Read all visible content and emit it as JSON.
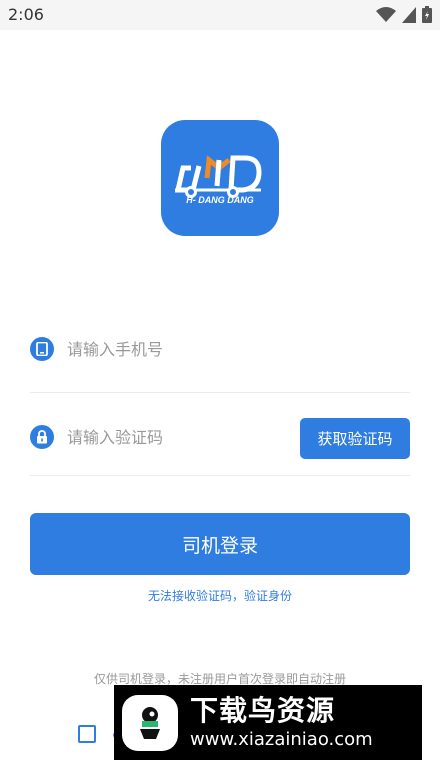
{
  "status_bar": {
    "time": "2:06"
  },
  "logo": {
    "text": "H- DANG DANG"
  },
  "phone_field": {
    "placeholder": "请输入手机号"
  },
  "code_field": {
    "placeholder": "请输入验证码",
    "button_label": "获取验证码"
  },
  "login_button": {
    "label": "司机登录"
  },
  "help_link": {
    "text": "无法接收验证码，验证身份"
  },
  "notice": {
    "text": "仅供司机登录，未注册用户首次登录即自动注册"
  },
  "agreement": {
    "visible_text": "《"
  },
  "watermark": {
    "title": "下载鸟资源",
    "url": "www.xiazainiao.com"
  },
  "colors": {
    "accent": "#2f7de1",
    "background": "#ffffff"
  }
}
